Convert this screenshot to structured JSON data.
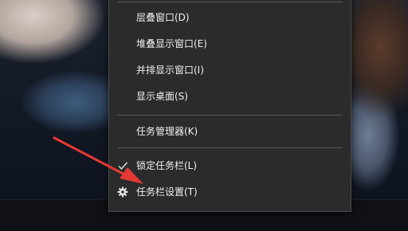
{
  "context_menu": {
    "items": [
      {
        "label": "层叠窗口(D)"
      },
      {
        "label": "堆叠显示窗口(E)"
      },
      {
        "label": "并排显示窗口(I)"
      },
      {
        "label": "显示桌面(S)"
      },
      {
        "label": "任务管理器(K)"
      },
      {
        "label": "锁定任务栏(L)",
        "checked": true,
        "icon": "checkmark-icon"
      },
      {
        "label": "任务栏设置(T)",
        "icon": "gear-icon"
      }
    ]
  },
  "annotation": {
    "color": "#e53935"
  }
}
